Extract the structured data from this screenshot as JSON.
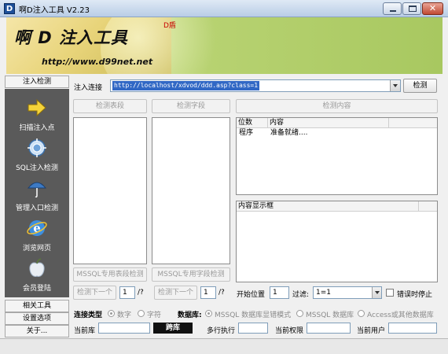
{
  "window": {
    "title": "啊D注入工具 V2.23",
    "icon_letter": "D"
  },
  "banner": {
    "title": "啊 D 注入工具",
    "url": "http://www.d99net.net",
    "tag": "D盾"
  },
  "sidebar": {
    "header": "注入检测",
    "items": [
      {
        "label": "扫描注入点",
        "icon": "arrow-right-icon"
      },
      {
        "label": "SQL注入检测",
        "icon": "sql-scan-icon"
      },
      {
        "label": "管理入口检测",
        "icon": "admin-umbrella-icon"
      },
      {
        "label": "浏览网页",
        "icon": "ie-browser-icon"
      },
      {
        "label": "会员登陆",
        "icon": "apple-member-icon"
      }
    ],
    "footer_tabs": [
      "相关工具",
      "设置选项",
      "关于..."
    ]
  },
  "inject": {
    "label": "注入连接",
    "url_value": "http://localhost/xdvod/ddd.asp?class=1",
    "detect_button": "检测"
  },
  "buttons": {
    "detect_tables": "检测表段",
    "detect_fields": "检测字段",
    "detect_content": "检测内容",
    "mssql_tables": "MSSQL专用表段检测",
    "mssql_fields": "MSSQL专用字段检测",
    "detect_next_1": "检测下一个",
    "detect_next_2": "检测下一个"
  },
  "content_grid": {
    "columns": [
      "位数",
      "内容"
    ],
    "rows": [
      [
        "程序",
        "准备就绪...."
      ]
    ]
  },
  "display_grid": {
    "header": "内容显示框"
  },
  "controls": {
    "spin1_value": "1",
    "spin1_suffix": "/?",
    "spin2_value": "1",
    "spin2_suffix": "/?",
    "start_label": "开始位置",
    "start_value": "1",
    "filter_label": "过滤:",
    "filter_value": "1=1",
    "error_stop_label": "错误时停止"
  },
  "connection": {
    "type_label": "连接类型",
    "type_options": [
      "数字",
      "字符"
    ],
    "db_label": "数据库:",
    "db_options": [
      "MSSQL 数据库显错模式",
      "MSSQL 数据库",
      "Access或其他数据库"
    ]
  },
  "status": {
    "current_db_label": "当前库",
    "cross_db_label": "跨库",
    "multi_exec_label": "多行执行",
    "current_perm_label": "当前权限",
    "current_user_label": "当前用户"
  },
  "colors": {
    "banner_green": "#b9d373",
    "sidebar_dark": "#5a5a5a",
    "selection_blue": "#3168c5",
    "close_red": "#c14a33"
  }
}
